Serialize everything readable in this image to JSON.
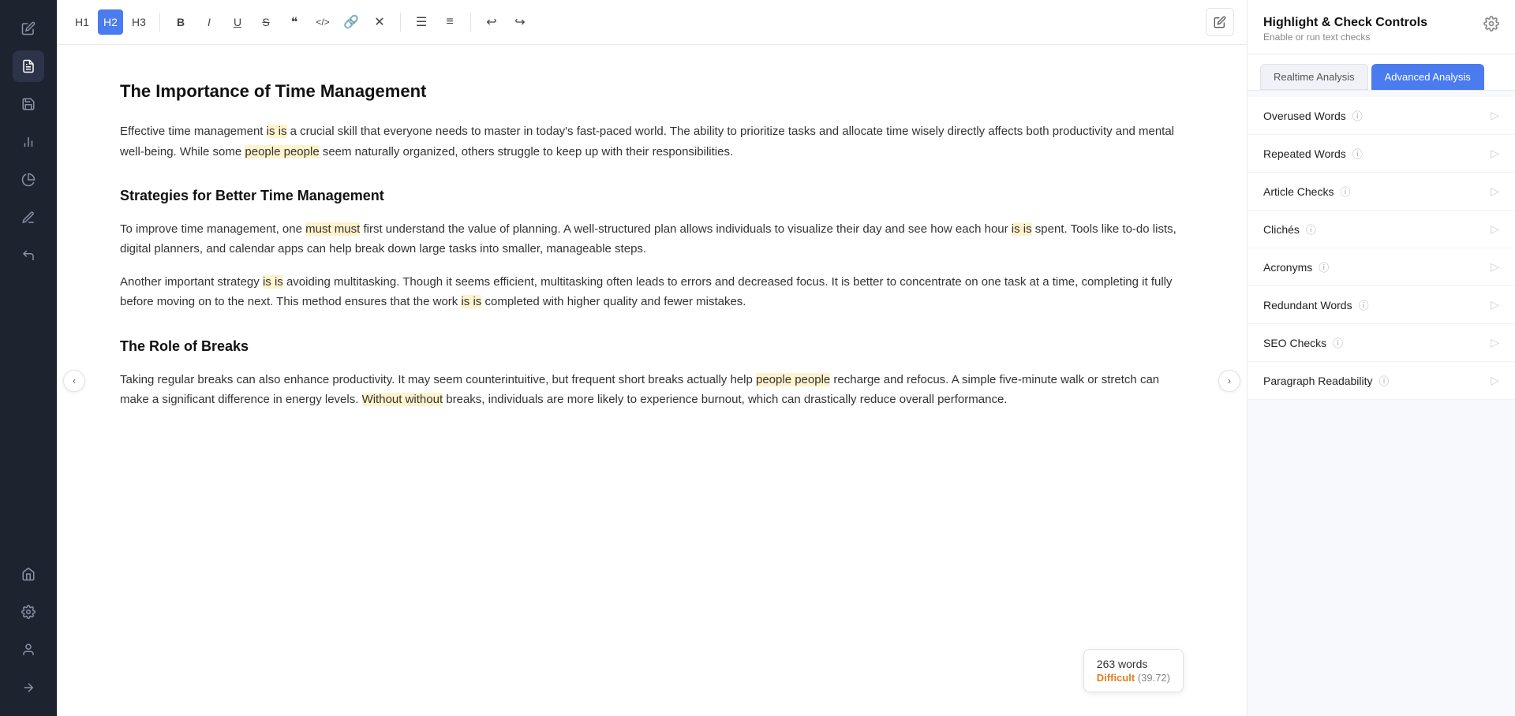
{
  "sidebar": {
    "icons": [
      {
        "name": "edit-icon",
        "symbol": "✏️",
        "active": false
      },
      {
        "name": "document-icon",
        "symbol": "📄",
        "active": true
      },
      {
        "name": "save-icon",
        "symbol": "💾",
        "active": false
      },
      {
        "name": "chart-icon",
        "symbol": "📊",
        "active": false
      },
      {
        "name": "pie-chart-icon",
        "symbol": "🥧",
        "active": false
      },
      {
        "name": "pencil-icon",
        "symbol": "✍️",
        "active": false
      },
      {
        "name": "hook-icon",
        "symbol": "↩",
        "active": false
      },
      {
        "name": "home-icon",
        "symbol": "🏠",
        "active": false
      },
      {
        "name": "settings-icon",
        "symbol": "⚙️",
        "active": false
      },
      {
        "name": "user-icon",
        "symbol": "👤",
        "active": false
      },
      {
        "name": "arrow-icon",
        "symbol": "→",
        "active": false
      }
    ]
  },
  "toolbar": {
    "buttons": [
      {
        "name": "h1-button",
        "label": "H1",
        "active": false
      },
      {
        "name": "h2-button",
        "label": "H2",
        "active": true
      },
      {
        "name": "h3-button",
        "label": "H3",
        "active": false
      },
      {
        "name": "bold-button",
        "label": "B",
        "active": false
      },
      {
        "name": "italic-button",
        "label": "I",
        "active": false
      },
      {
        "name": "underline-button",
        "label": "U",
        "active": false
      },
      {
        "name": "strikethrough-button",
        "label": "S",
        "active": false
      },
      {
        "name": "quote-button",
        "label": "\"\"",
        "active": false
      },
      {
        "name": "code-button",
        "label": "<>",
        "active": false
      },
      {
        "name": "link-button",
        "label": "🔗",
        "active": false
      },
      {
        "name": "remove-button",
        "label": "✕",
        "active": false
      },
      {
        "name": "bullet-list-button",
        "label": "☰",
        "active": false
      },
      {
        "name": "ordered-list-button",
        "label": "≡",
        "active": false
      },
      {
        "name": "undo-button",
        "label": "↩",
        "active": false
      },
      {
        "name": "redo-button",
        "label": "↪",
        "active": false
      }
    ],
    "edit_button_tooltip": "Edit mode"
  },
  "editor": {
    "title": "The Importance of Time Management",
    "paragraphs": [
      "Effective time management is is a crucial skill that everyone needs to master in today's fast-paced world. The ability to prioritize tasks and allocate time wisely directly affects both productivity and mental well-being. While some people people seem naturally organized, others struggle to keep up with their responsibilities.",
      "Strategies for Better Time Management",
      "To improve time management, one must must first understand the value of planning. A well-structured plan allows individuals to visualize their day and see how each hour is is spent. Tools like to-do lists, digital planners, and calendar apps can help break down large tasks into smaller, manageable steps.",
      "Another important strategy is is avoiding multitasking. Though it seems efficient, multitasking often leads to errors and decreased focus. It is better to concentrate on one task at a time, completing it fully before moving on to the next. This method ensures that the work is is completed with higher quality and fewer mistakes.",
      "The Role of Breaks",
      "Taking regular breaks can also enhance productivity. It may seem counterintuitive, but frequent short breaks actually help people people recharge and refocus. A simple five-minute walk or stretch can make a significant difference in energy levels. Without without breaks, individuals are more likely to experience burnout, which can drastically reduce overall performance."
    ],
    "word_count": "263 words",
    "difficulty_label": "Difficult",
    "difficulty_score": "(39.72)"
  },
  "panel": {
    "title": "Highlight & Check Controls",
    "subtitle": "Enable or run text checks",
    "tabs": [
      {
        "name": "realtime-tab",
        "label": "Realtime Analysis",
        "active": false
      },
      {
        "name": "advanced-tab",
        "label": "Advanced Analysis",
        "active": true
      }
    ],
    "checks": [
      {
        "name": "overused-words",
        "label": "Overused Words"
      },
      {
        "name": "repeated-words",
        "label": "Repeated Words"
      },
      {
        "name": "article-checks",
        "label": "Article Checks"
      },
      {
        "name": "cliches",
        "label": "Clichés"
      },
      {
        "name": "acronyms",
        "label": "Acronyms"
      },
      {
        "name": "redundant-words",
        "label": "Redundant Words"
      },
      {
        "name": "seo-checks",
        "label": "SEO Checks"
      },
      {
        "name": "paragraph-readability",
        "label": "Paragraph Readability"
      }
    ]
  }
}
